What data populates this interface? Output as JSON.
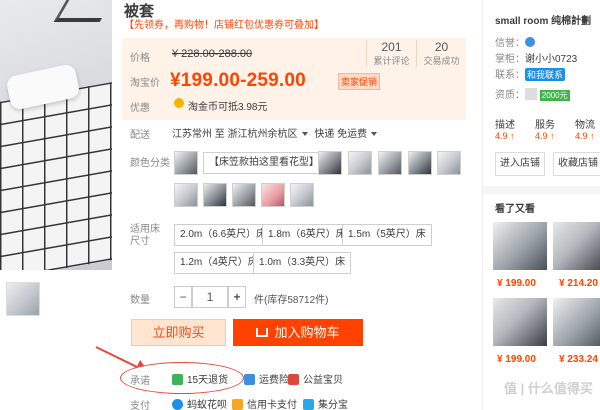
{
  "product": {
    "title": "被套",
    "promo": "【先领券，再购物！店铺红包优惠券可叠加】"
  },
  "price": {
    "label_price": "价格",
    "original": "¥ 228.00-288.00",
    "label_taobao": "淘宝价",
    "current": "¥199.00-259.00",
    "shop_tag": "卖家促销",
    "label_discount": "优惠",
    "coin_text": "淘金币可抵3.98元",
    "stats": [
      {
        "value": "201",
        "label": "累计评论"
      },
      {
        "value": "20",
        "label": "交易成功"
      }
    ]
  },
  "delivery": {
    "label": "配送",
    "from": "江苏常州",
    "to_word": "至",
    "to": "浙江杭州余杭区",
    "method": "快递 免运费"
  },
  "color": {
    "label": "颜色分类",
    "text_option": "【床笠款拍这里看花型】"
  },
  "size": {
    "label": "适用床尺寸",
    "options": [
      "2.0m（6.6英尺）床",
      "1.8m（6英尺）床",
      "1.5m（5英尺）床",
      "1.2m（4英尺）床",
      "1.0m（3.3英尺）床"
    ]
  },
  "quantity": {
    "label": "数量",
    "minus": "−",
    "value": "1",
    "plus": "+",
    "stock": "件(库存58712件)"
  },
  "actions": {
    "buy_now": "立即购买",
    "add_cart": "加入购物车"
  },
  "services": {
    "promise_label": "承诺",
    "promise_items": [
      "15天退货",
      "运费险",
      "公益宝贝"
    ],
    "pay_label": "支付",
    "pay_items": [
      "蚂蚁花呗",
      "信用卡支付",
      "集分宝"
    ]
  },
  "shop": {
    "name": "small room 纯棉計劃",
    "credit_label": "信誉：",
    "keeper_label": "掌柜：",
    "keeper": "谢小小0723",
    "contact_label": "联系：",
    "contact_btn": "和我联系",
    "quality_label": "资质：",
    "quality_badge": "2000元",
    "dsr": [
      {
        "label": "描述",
        "score": "4.9 ↑"
      },
      {
        "label": "服务",
        "score": "4.9 ↑"
      },
      {
        "label": "物流",
        "score": "4.9 ↑"
      }
    ],
    "enter_btn": "进入店铺",
    "fav_btn": "收藏店铺",
    "also_title": "看了又看",
    "recommend": [
      "¥ 199.00",
      "¥ 214.20",
      "¥ 199.00",
      "¥ 233.24"
    ]
  },
  "watermark": "值 | 什么值得买",
  "colors": {
    "accent": "#ff4400",
    "price_bg": "#fff2e8",
    "buy_bg": "#ffe4d0",
    "cart_bg": "#ff4200",
    "annotation": "#e64a3b"
  }
}
